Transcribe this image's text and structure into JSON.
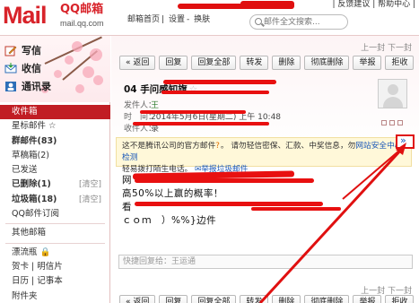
{
  "header": {
    "logo_mail": "Mail",
    "logo_qq": "QQ邮箱",
    "logo_url": "mail.qq.com",
    "links": [
      "邮箱首页",
      "设置",
      "换肤"
    ],
    "top_right": "| 反馈建议 | 帮助中心 |",
    "search_placeholder": "邮件全文搜索..."
  },
  "sidebar": {
    "compose_label": "写信",
    "receive_label": "收信",
    "contacts_label": "通讯录",
    "folders": [
      {
        "label": "收件箱",
        "active": true
      },
      {
        "label": "星标邮件 ☆"
      },
      {
        "label": "群邮件(83)",
        "bold": true
      },
      {
        "label": "草稿箱(2)"
      },
      {
        "label": "已发送"
      },
      {
        "label": "已删除(1)",
        "bold": true,
        "clear": "[清空]"
      },
      {
        "label": "垃圾箱(18)",
        "bold": true,
        "clear": "[清空]"
      },
      {
        "label": "QQ邮件订阅"
      }
    ],
    "other": [
      {
        "label": "其他邮箱"
      }
    ],
    "apps": [
      {
        "label": "漂流瓶 🔒"
      },
      {
        "label": "贺卡 | 明信片"
      },
      {
        "label": "日历 | 记事本"
      },
      {
        "label": "附件夹"
      }
    ]
  },
  "main": {
    "pager_top": "上一封  下一封",
    "pager_bottom": "上一封  下一封",
    "toolbar": [
      "« 返回",
      "回复",
      "回复全部",
      "转发",
      "删除",
      "彻底删除",
      "举报",
      "拒收"
    ],
    "subject": "04 手问感知旗",
    "star": "☆",
    "from_key": "发件人：",
    "from_val": "王",
    "time_key": "时　间：",
    "time_val": "2014年5月6日(星期二) 上午 10:48",
    "to_key": "收件人：",
    "to_val": "录",
    "notice_line1": "这不是腾讯公司的官方邮件",
    "notice_warn": "?",
    "notice_line1b": "。 请勿轻信密保、汇款、中奖信息，勿",
    "notice_link": "网站安全中心检测",
    "notice_line2": "轻易拨打陌生电话。",
    "notice_report": "举报垃圾邮件",
    "body_line1": "网",
    "body_line2": "高50%以上赢的概率！",
    "body_line3": "看",
    "body_line4": "ｃｏｍ　）%%}边件",
    "reply_placeholder": "快捷回复给：王运通"
  }
}
